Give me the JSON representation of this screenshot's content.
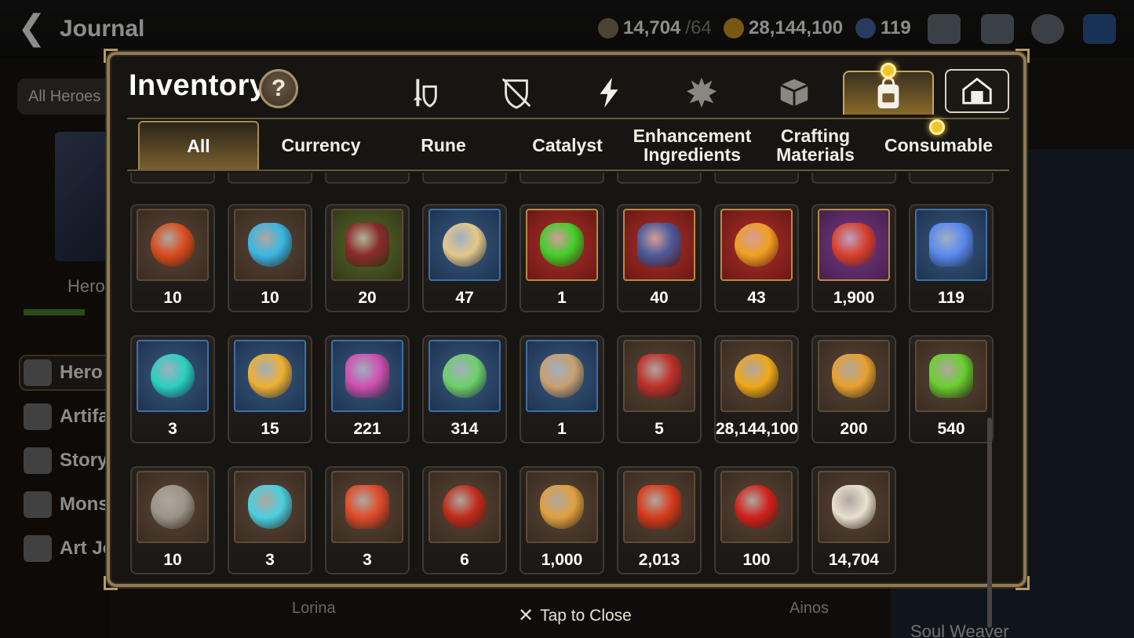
{
  "background": {
    "title": "Journal",
    "resources": {
      "stamina": "14,704",
      "stamina_max": "/64",
      "gold": "28,144,100",
      "skystone": "119"
    },
    "heroes_pill": "All Heroes",
    "hero_label": "Hero",
    "menu": [
      "Hero J",
      "Artifa",
      "Story",
      "Monst",
      "Art Jo"
    ],
    "bottom_names": [
      "Lorina",
      "Ainos"
    ],
    "right_label": "Soul Weaver"
  },
  "modal": {
    "title": "Inventory",
    "help": "?",
    "category_icons": [
      "sword-shield-icon",
      "broken-shield-icon",
      "lightning-icon",
      "spiky-gear-icon",
      "cube-icon",
      "backpack-icon",
      "storage-house-icon"
    ],
    "sub_tabs": [
      "All",
      "Currency",
      "Rune",
      "Catalyst",
      "Enhancement Ingredients",
      "Crafting Materials",
      "Consumable"
    ],
    "items": [
      {
        "name": "red-rune-icon",
        "qty": "10",
        "frame": "brown",
        "color": "#d94a1c"
      },
      {
        "name": "blue-rune-icon",
        "qty": "10",
        "frame": "brown",
        "color": "#39b7e4"
      },
      {
        "name": "claw-icon",
        "qty": "20",
        "frame": "green",
        "color": "#8a2a2a"
      },
      {
        "name": "feather-herb-icon",
        "qty": "47",
        "frame": "blue",
        "color": "#e5c88a"
      },
      {
        "name": "green-orb-icon",
        "qty": "1",
        "frame": "red",
        "color": "#3fcf2a"
      },
      {
        "name": "coiled-rope-icon",
        "qty": "40",
        "frame": "red",
        "color": "#4a5a9a"
      },
      {
        "name": "amber-crystal-icon",
        "qty": "43",
        "frame": "red",
        "color": "#f0a020"
      },
      {
        "name": "red-flower-ring-icon",
        "qty": "1,900",
        "frame": "purple",
        "color": "#d8402a"
      },
      {
        "name": "skystone-icon",
        "qty": "119",
        "frame": "blue",
        "color": "#5a8af0"
      },
      {
        "name": "teal-crystal-icon",
        "qty": "3",
        "frame": "blue",
        "color": "#2ad0c0"
      },
      {
        "name": "compass-star-icon",
        "qty": "15",
        "frame": "blue",
        "color": "#f0b030"
      },
      {
        "name": "pink-mountain-icon",
        "qty": "221",
        "frame": "blue",
        "color": "#d050b0"
      },
      {
        "name": "green-leaf-icon",
        "qty": "314",
        "frame": "blue",
        "color": "#6fd06a"
      },
      {
        "name": "bookmark-key-icon",
        "qty": "1",
        "frame": "blue",
        "color": "#c8a070"
      },
      {
        "name": "war-banner-icon",
        "qty": "5",
        "frame": "brown",
        "color": "#c0302a"
      },
      {
        "name": "gold-coin-icon",
        "qty": "28,144,100",
        "frame": "brown",
        "color": "#f0a818"
      },
      {
        "name": "gold-emblem-icon",
        "qty": "200",
        "frame": "brown",
        "color": "#e8a030"
      },
      {
        "name": "green-heart-icon",
        "qty": "540",
        "frame": "brown",
        "color": "#6ad030"
      },
      {
        "name": "stone-compass-icon",
        "qty": "10",
        "frame": "brown",
        "color": "#9a9488"
      },
      {
        "name": "robot-pod-icon",
        "qty": "3",
        "frame": "brown",
        "color": "#4ad0e0"
      },
      {
        "name": "red-seal-icon",
        "qty": "3",
        "frame": "brown",
        "color": "#e04a2a"
      },
      {
        "name": "lava-orb-icon",
        "qty": "6",
        "frame": "brown",
        "color": "#c02a1a"
      },
      {
        "name": "fist-badge-icon",
        "qty": "1,000",
        "frame": "brown",
        "color": "#e0a040"
      },
      {
        "name": "red-leaves-icon",
        "qty": "2,013",
        "frame": "brown",
        "color": "#d83a1a"
      },
      {
        "name": "red-band-icon",
        "qty": "100",
        "frame": "brown",
        "color": "#d0201a"
      },
      {
        "name": "chess-knight-icon",
        "qty": "14,704",
        "frame": "brown",
        "color": "#e8e0d0"
      }
    ]
  },
  "footer": {
    "close_label": "Tap to Close"
  },
  "colors": {
    "accent_gold": "#c9a455",
    "modal_border": "#8f7a52",
    "notif": "#f4c430"
  }
}
